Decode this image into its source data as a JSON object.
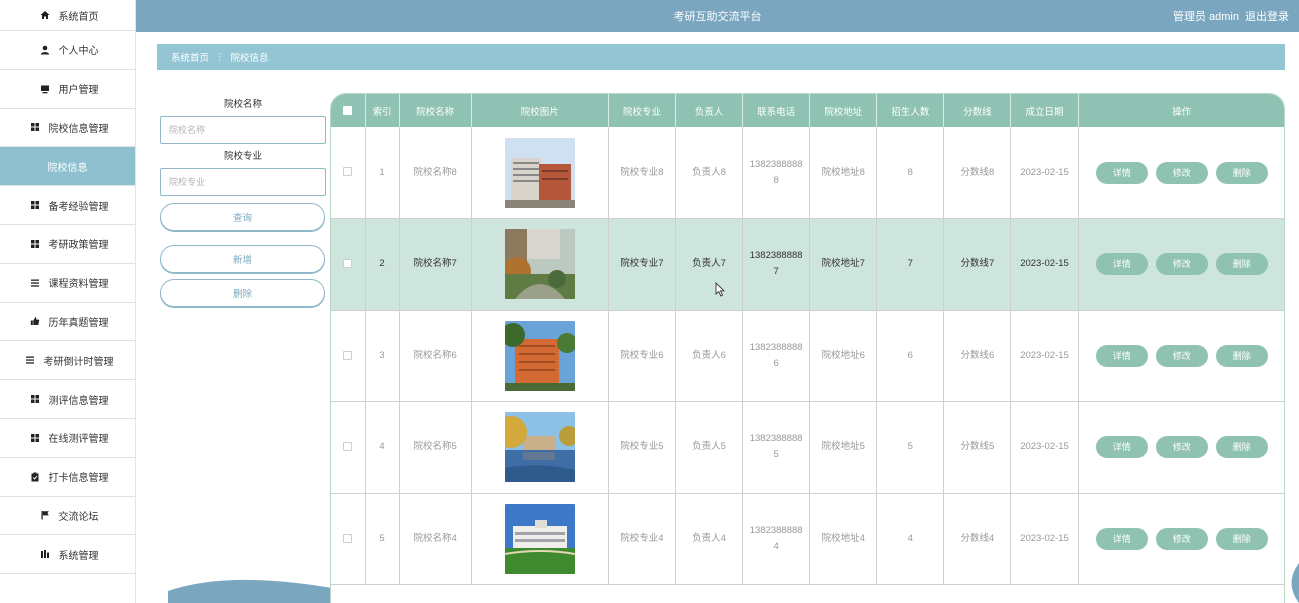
{
  "app": {
    "title": "考研互助交流平台",
    "user_label": "管理员 admin",
    "logout_label": "退出登录"
  },
  "sidebar": {
    "items": [
      {
        "label": "系统首页",
        "icon": "home-icon"
      },
      {
        "label": "个人中心",
        "icon": "user-icon"
      },
      {
        "label": "用户管理",
        "icon": "monitor-icon"
      },
      {
        "label": "院校信息管理",
        "icon": "grid-icon"
      },
      {
        "label": "院校信息",
        "icon": "",
        "active": true
      },
      {
        "label": "备考经验管理",
        "icon": "grid-icon"
      },
      {
        "label": "考研政策管理",
        "icon": "grid-icon"
      },
      {
        "label": "课程资料管理",
        "icon": "list-icon"
      },
      {
        "label": "历年真题管理",
        "icon": "thumb-icon"
      },
      {
        "label": "考研倒计时管理",
        "icon": "list-icon"
      },
      {
        "label": "测评信息管理",
        "icon": "grid-icon"
      },
      {
        "label": "在线测评管理",
        "icon": "grid-icon"
      },
      {
        "label": "打卡信息管理",
        "icon": "clipboard-icon"
      },
      {
        "label": "交流论坛",
        "icon": "flag-icon"
      },
      {
        "label": "系统管理",
        "icon": "chart-icon"
      }
    ]
  },
  "breadcrumb": {
    "home": "系统首页",
    "separator": "⋮",
    "current": "院校信息"
  },
  "search": {
    "name_label": "院校名称",
    "name_placeholder": "院校名称",
    "major_label": "院校专业",
    "major_placeholder": "院校专业",
    "query_button": "查询",
    "add_button": "新增",
    "delete_button": "删除"
  },
  "table": {
    "headers": [
      "索引",
      "院校名称",
      "院校图片",
      "院校专业",
      "负责人",
      "联系电话",
      "院校地址",
      "招生人数",
      "分数线",
      "成立日期",
      "操作"
    ],
    "actions": {
      "detail": "详情",
      "edit": "修改",
      "delete": "删除"
    },
    "rows": [
      {
        "index": "1",
        "name": "院校名称8",
        "image": "campus-building-orange",
        "major": "院校专业8",
        "person": "负责人8",
        "phone": "13823888888",
        "address": "院校地址8",
        "count": "8",
        "score": "分数线8",
        "date": "2023-02-15"
      },
      {
        "index": "2",
        "name": "院校名称7",
        "image": "campus-garden",
        "major": "院校专业7",
        "person": "负责人7",
        "phone": "13823888887",
        "address": "院校地址7",
        "count": "7",
        "score": "分数线7",
        "date": "2023-02-15",
        "highlighted": true
      },
      {
        "index": "3",
        "name": "院校名称6",
        "image": "campus-red-building",
        "major": "院校专业6",
        "person": "负责人6",
        "phone": "13823888886",
        "address": "院校地址6",
        "count": "6",
        "score": "分数线6",
        "date": "2023-02-15"
      },
      {
        "index": "4",
        "name": "院校名称5",
        "image": "campus-lake",
        "major": "院校专业5",
        "person": "负责人5",
        "phone": "13823888885",
        "address": "院校地址5",
        "count": "5",
        "score": "分数线5",
        "date": "2023-02-15"
      },
      {
        "index": "5",
        "name": "院校名称4",
        "image": "campus-lawn",
        "major": "院校专业4",
        "person": "负责人4",
        "phone": "13823888884",
        "address": "院校地址4",
        "count": "4",
        "score": "分数线4",
        "date": "2023-02-15"
      }
    ]
  },
  "colors": {
    "topbar": "#7aa7bf",
    "breadcrumb": "#93c5d5",
    "sidebar_active": "#8fc0cf",
    "table_header": "#8fc2b2",
    "row_highlight": "#cde5dc",
    "action_button": "#8fc2b2"
  }
}
